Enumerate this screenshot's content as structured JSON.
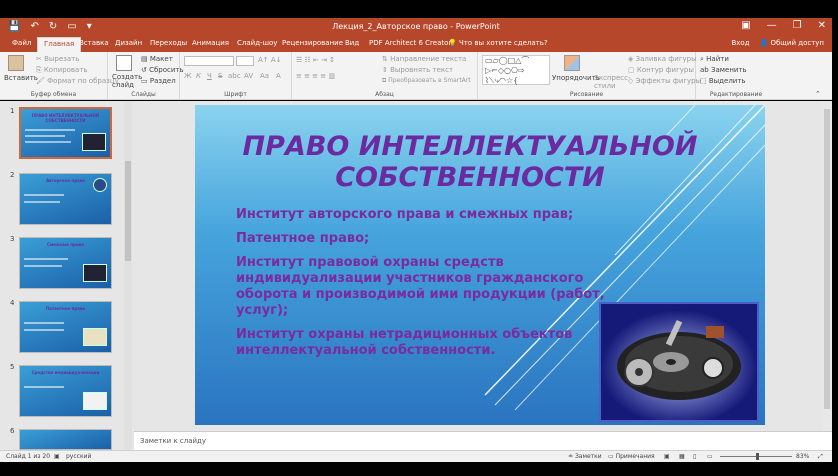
{
  "window": {
    "title": "Лекция_2_Авторское право - PowerPoint",
    "controls": [
      "▣",
      "—",
      "❐",
      "✕"
    ]
  },
  "tabs": {
    "items": [
      "Файл",
      "Главная",
      "Вставка",
      "Дизайн",
      "Переходы",
      "Анимация",
      "Слайд-шоу",
      "Рецензирование",
      "Вид",
      "PDF Architect 6 Creator"
    ],
    "active": "Главная",
    "tell_me": "Что вы хотите сделать?",
    "signin": "Вход",
    "share": "Общий доступ"
  },
  "ribbon": {
    "clipboard": {
      "paste": "Вставить",
      "cut": "Вырезать",
      "copy": "Копировать",
      "format_painter": "Формат по образцу",
      "label": "Буфер обмена"
    },
    "slides": {
      "new_slide": "Создать слайд",
      "layout": "Макет",
      "reset": "Сбросить",
      "section": "Раздел",
      "label": "Слайды"
    },
    "font": {
      "bold": "Ж",
      "italic": "К",
      "underline": "Ч",
      "strike": "S",
      "shadow": "abc",
      "spacing": "AV",
      "case": "Aa",
      "label": "Шрифт"
    },
    "paragraph": {
      "text_direction": "Направление текста",
      "align_text": "Выровнять текст",
      "smartart": "Преобразовать в SmartArt",
      "label": "Абзац"
    },
    "drawing": {
      "arrange": "Упорядочить",
      "quick_styles": "Экспресс-стили",
      "fill": "Заливка фигуры",
      "outline": "Контур фигуры",
      "effects": "Эффекты фигуры",
      "label": "Рисование"
    },
    "editing": {
      "find": "Найти",
      "replace": "Заменить",
      "select": "Выделить",
      "label": "Редактирование"
    }
  },
  "thumbnails": [
    {
      "num": "1",
      "title": "ПРАВО ИНТЕЛЛЕКТУАЛЬНОЙ СОБСТВЕННОСТИ"
    },
    {
      "num": "2",
      "title": "Авторское право"
    },
    {
      "num": "3",
      "title": "Смежные права"
    },
    {
      "num": "4",
      "title": "Патентное право"
    },
    {
      "num": "5",
      "title": "Средства индивидуализации"
    },
    {
      "num": "6",
      "title": ""
    }
  ],
  "slide": {
    "title_line1": "ПРАВО ИНТЕЛЛЕКТУАЛЬНОЙ",
    "title_line2": "СОБСТВЕННОСТИ",
    "bullets": [
      "Институт авторского права и смежных прав;",
      "Патентное право;",
      "Институт правовой охраны средств индивидуализации участников гражданского оборота и производимой ими продукции (работ, услуг);",
      "Институт охраны нетрадиционных объектов интеллектуальной собственности."
    ]
  },
  "notes_placeholder": "Заметки к слайду",
  "status": {
    "slide_info": "Слайд 1 из 20",
    "language": "русский",
    "notes": "Заметки",
    "comments": "Примечания",
    "zoom": "83%"
  },
  "colors": {
    "accent": "#b7472a",
    "slide_text": "#6b2aa0"
  }
}
